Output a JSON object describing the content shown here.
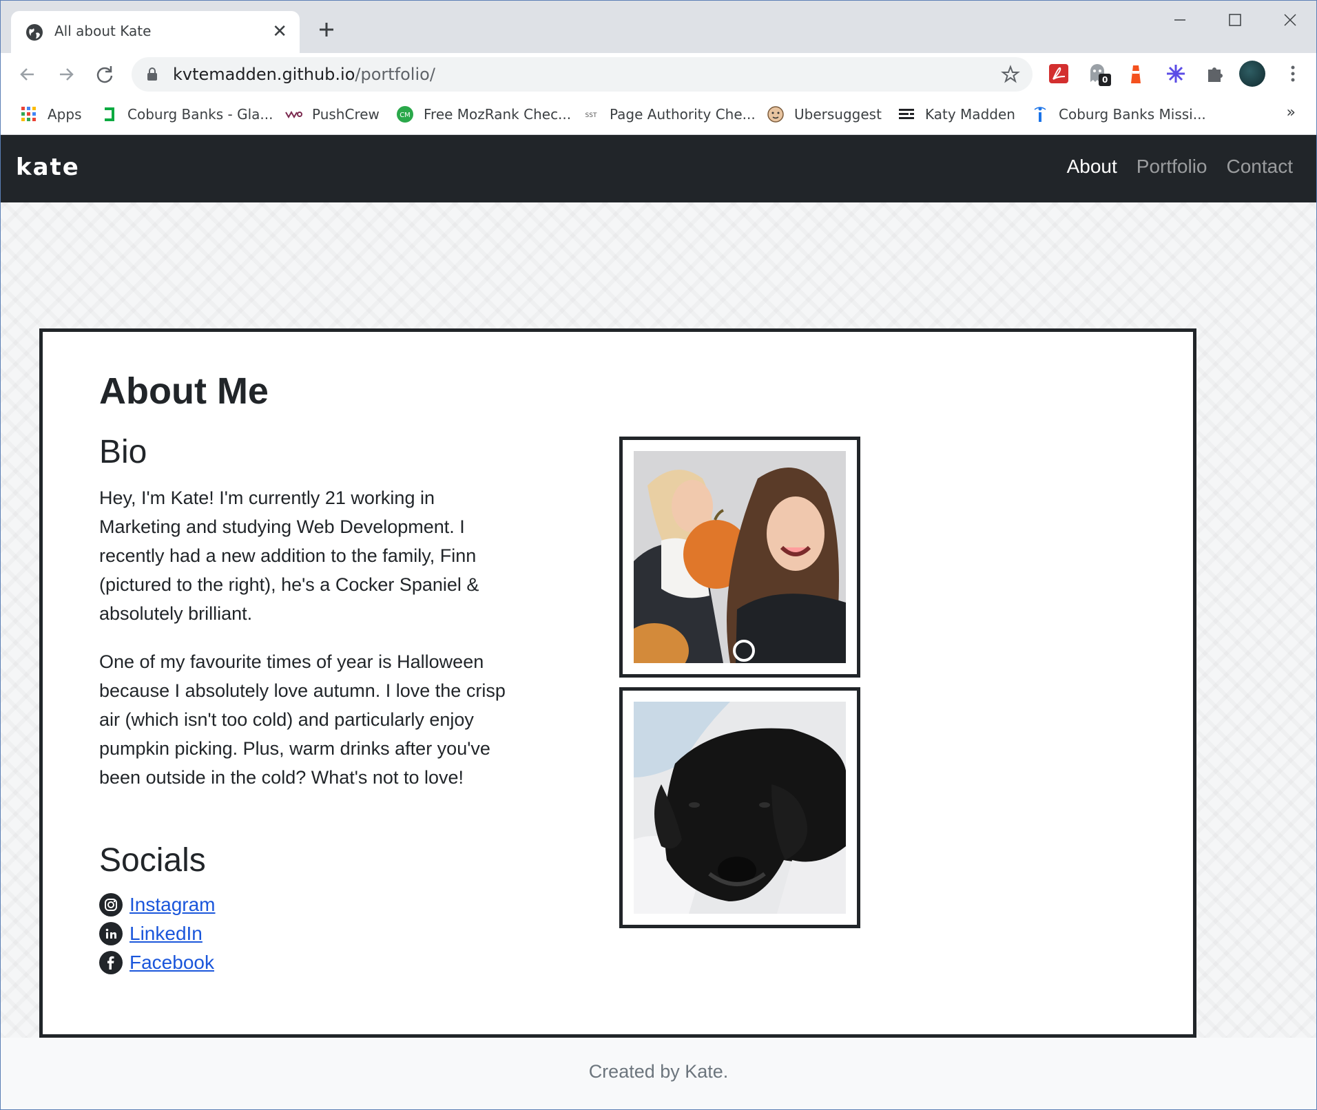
{
  "browser": {
    "tab_title": "All about Kate",
    "url_host": "kvtemadden.github.io",
    "url_path": "/portfolio/",
    "extension_badge": "0",
    "bookmarks": [
      {
        "label": "Apps",
        "icon": "apps-grid-icon"
      },
      {
        "label": "Coburg Banks - Gla...",
        "icon": "glassdoor-icon"
      },
      {
        "label": "PushCrew",
        "icon": "vwo-icon"
      },
      {
        "label": "Free MozRank Chec...",
        "icon": "cm-icon"
      },
      {
        "label": "Page Authority Che...",
        "icon": "sst-icon"
      },
      {
        "label": "Ubersuggest",
        "icon": "ubersuggest-icon"
      },
      {
        "label": "Katy Madden",
        "icon": "menu-lines-icon"
      },
      {
        "label": "Coburg Banks Missi...",
        "icon": "info-icon"
      }
    ],
    "bookmarks_more": "»"
  },
  "nav": {
    "brand": "kate",
    "links": [
      "About",
      "Portfolio",
      "Contact"
    ],
    "active": "About"
  },
  "about": {
    "heading": "About Me",
    "bio_title": "Bio",
    "bio_p1": "Hey, I'm Kate! I'm currently 21 working in Marketing and studying Web Development. I recently had a new addition to the family, Finn (pictured to the right), he's a Cocker Spaniel & absolutely brilliant.",
    "bio_p2": "One of my favourite times of year is Halloween because I absolutely love autumn. I love the crisp air (which isn't too cold) and particularly enjoy pumpkin picking. Plus, warm drinks after you've been outside in the cold? What's not to love!",
    "socials_title": "Socials",
    "socials": [
      {
        "label": "Instagram",
        "icon": "instagram-icon"
      },
      {
        "label": "LinkedIn",
        "icon": "linkedin-icon"
      },
      {
        "label": "Facebook",
        "icon": "facebook-icon"
      }
    ]
  },
  "footer": {
    "text": "Created by Kate."
  },
  "colors": {
    "navbar": "#212529",
    "link": "#1a56db",
    "footer_text": "#6c757d"
  }
}
